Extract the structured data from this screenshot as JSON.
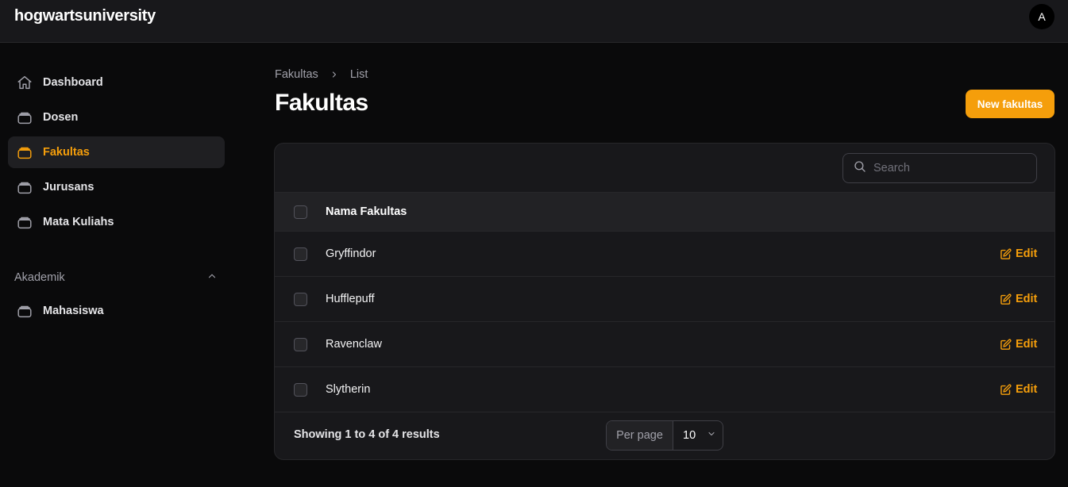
{
  "app": {
    "brand": "hogwartsuniversity",
    "avatar_initial": "A"
  },
  "sidebar": {
    "items": [
      {
        "label": "Dashboard",
        "icon": "home-icon",
        "active": false
      },
      {
        "label": "Dosen",
        "icon": "collection-icon",
        "active": false
      },
      {
        "label": "Fakultas",
        "icon": "collection-icon",
        "active": true
      },
      {
        "label": "Jurusans",
        "icon": "collection-icon",
        "active": false
      },
      {
        "label": "Mata Kuliahs",
        "icon": "collection-icon",
        "active": false
      }
    ],
    "group": {
      "label": "Akademik",
      "items": [
        {
          "label": "Mahasiswa",
          "icon": "collection-icon",
          "active": false
        }
      ]
    }
  },
  "breadcrumb": {
    "items": [
      "Fakultas",
      "List"
    ]
  },
  "page": {
    "title": "Fakultas",
    "new_button": "New fakultas"
  },
  "table": {
    "search_placeholder": "Search",
    "columns": [
      "Nama Fakultas"
    ],
    "rows": [
      {
        "name": "Gryffindor",
        "action": "Edit"
      },
      {
        "name": "Hufflepuff",
        "action": "Edit"
      },
      {
        "name": "Ravenclaw",
        "action": "Edit"
      },
      {
        "name": "Slytherin",
        "action": "Edit"
      }
    ],
    "footer": {
      "summary": "Showing 1 to 4 of 4 results",
      "per_page_label": "Per page",
      "per_page_value": "10"
    }
  },
  "colors": {
    "accent": "#f59e0b",
    "background": "#0a0a0b",
    "surface": "#18181b"
  }
}
